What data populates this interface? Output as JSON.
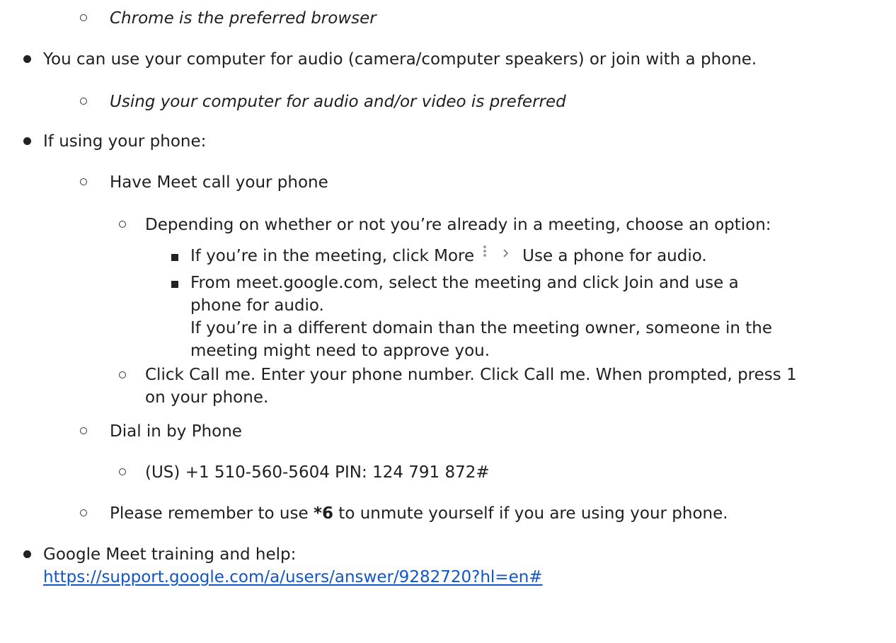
{
  "doc": {
    "l1": "Chrome is the preferred browser",
    "l2": "You can use your computer for audio (camera/computer speakers) or join with a phone.",
    "l3": "Using your computer for audio and/or video is preferred",
    "l4": "If using your phone:",
    "l5": "Have Meet call your phone",
    "l6": "Depending on whether or not you’re already in a meeting, choose an option:",
    "l7a": "If you’re in the meeting, click More",
    "l7b": "Use a phone for audio.",
    "l8a": "From meet.google.com, select the meeting and click Join and use a",
    "l8b": "phone for audio.",
    "l8c": "If you’re in a different domain than the meeting owner, someone in the",
    "l8d": "meeting might need to approve you.",
    "l9a": "Click Call me. Enter your phone number. Click Call me. When prompted, press 1",
    "l9b": "on your phone.",
    "l10": "Dial in by Phone",
    "l11": "(US) +1 510-560-5604 PIN: 124 791 872#",
    "l12a": "Please remember to use ",
    "l12b": "*6",
    "l12c": " to unmute yourself if you are using your phone.",
    "l13": "Google Meet training and help:",
    "link": "https://support.google.com/a/users/answer/9282720?hl=en#"
  },
  "icons": {
    "more": "more-vert-icon",
    "chevron": "chevron-right-icon"
  }
}
